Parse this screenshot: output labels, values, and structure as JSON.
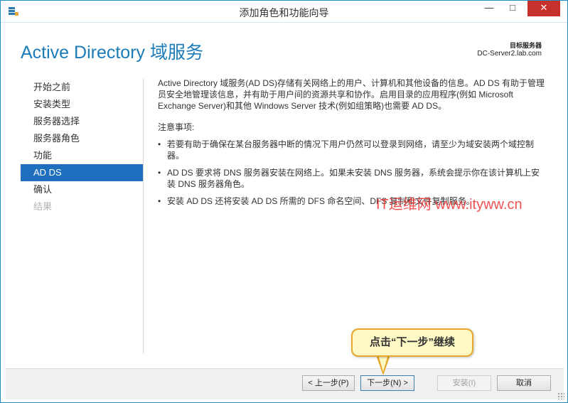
{
  "window": {
    "title": "添加角色和功能向导",
    "accent": "#1b7cb8",
    "close_color": "#c7312b"
  },
  "titlebar": {
    "minimize": "—",
    "maximize": "□",
    "close": "✕"
  },
  "header": {
    "title": "Active Directory 域服务",
    "destination_label": "目标服务器",
    "destination_value": "DC-Server2.lab.com"
  },
  "nav": {
    "items": [
      {
        "label": "开始之前",
        "state": "normal"
      },
      {
        "label": "安装类型",
        "state": "normal"
      },
      {
        "label": "服务器选择",
        "state": "normal"
      },
      {
        "label": "服务器角色",
        "state": "normal"
      },
      {
        "label": "功能",
        "state": "normal"
      },
      {
        "label": "AD DS",
        "state": "active"
      },
      {
        "label": "确认",
        "state": "normal"
      },
      {
        "label": "结果",
        "state": "disabled"
      }
    ]
  },
  "content": {
    "intro": "Active Directory 域服务(AD DS)存储有关网络上的用户、计算机和其他设备的信息。AD DS 有助于管理员安全地管理该信息，并有助于用户间的资源共享和协作。启用目录的应用程序(例如 Microsoft Exchange Server)和其他 Windows Server 技术(例如组策略)也需要 AD DS。",
    "notes_heading": "注意事项:",
    "notes": [
      "若要有助于确保在某台服务器中断的情况下用户仍然可以登录到网络，请至少为域安装两个域控制器。",
      "AD DS 要求将 DNS 服务器安装在网络上。如果未安装 DNS 服务器，系统会提示你在该计算机上安装 DNS 服务器角色。",
      "安装 AD DS 还将安装 AD DS 所需的 DFS 命名空间、DFS 复制和文件复制服务。"
    ]
  },
  "watermark": "IT运维网 www.ityww.cn",
  "footer": {
    "prev_label": "< 上一步(P)",
    "next_label": "下一步(N) >",
    "install_label": "安装(I)",
    "cancel_label": "取消"
  },
  "callout": {
    "text": "点击“下一步”继续"
  }
}
